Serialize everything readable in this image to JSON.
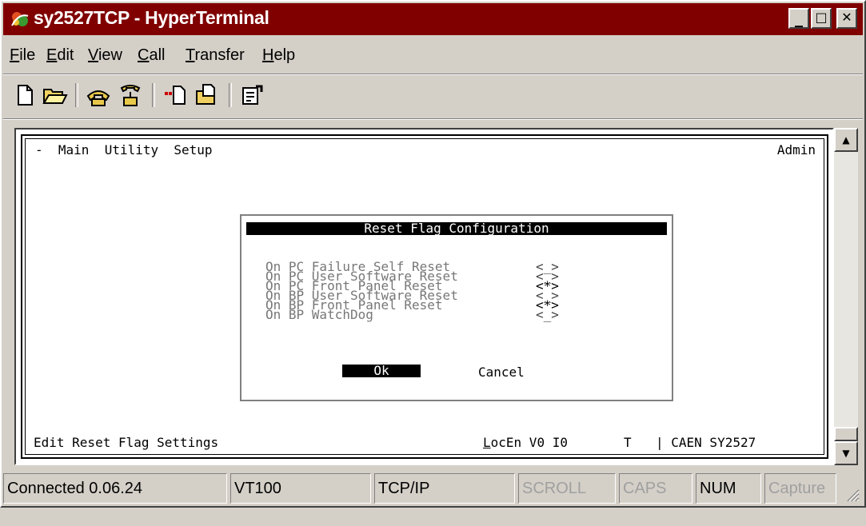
{
  "window": {
    "title": "sy2527TCP - HyperTerminal",
    "controls": {
      "minimize": "_",
      "maximize": "□",
      "close": "✕"
    }
  },
  "menu": {
    "items": [
      {
        "label": "File",
        "mnemonic": "F",
        "rest": "ile"
      },
      {
        "label": "Edit",
        "mnemonic": "E",
        "rest": "dit"
      },
      {
        "label": "View",
        "mnemonic": "V",
        "rest": "iew"
      },
      {
        "label": "Call",
        "mnemonic": "C",
        "rest": "all"
      },
      {
        "label": "Transfer",
        "mnemonic": "T",
        "rest": "ransfer"
      },
      {
        "label": "Help",
        "mnemonic": "H",
        "rest": "elp"
      }
    ]
  },
  "toolbar": {
    "icons": [
      "new-icon",
      "open-icon",
      "connect-icon",
      "disconnect-icon",
      "send-icon",
      "receive-icon",
      "properties-icon"
    ]
  },
  "terminal": {
    "top_menu": "-  Main  Utility  Setup",
    "user": "Admin",
    "dialog": {
      "title": "Reset Flag Configuration",
      "options": [
        {
          "label": "On PC Failure Self Reset",
          "value": "<_>"
        },
        {
          "label": "On PC User Software Reset",
          "value": "<_>"
        },
        {
          "label": "On PC Front Panel Reset",
          "value": "<*>"
        },
        {
          "label": "On BP User Software Reset",
          "value": "<_>"
        },
        {
          "label": "On BP Front Panel Reset",
          "value": "<*>"
        },
        {
          "label": "On BP WatchDog",
          "value": "<_>"
        }
      ],
      "ok_label": "Ok",
      "cancel_label": "Cancel"
    },
    "status_line": {
      "hint": "Edit Reset Flag Settings",
      "loc_mnemonic": "L",
      "loc_rest": "ocEn V0 I0",
      "flag": "T",
      "device": "| CAEN SY2527"
    }
  },
  "statusbar": {
    "connected": "Connected 0.06.24",
    "emulation": "VT100",
    "protocol": "TCP/IP",
    "scroll": "SCROLL",
    "caps": "CAPS",
    "num": "NUM",
    "capture": "Capture"
  }
}
